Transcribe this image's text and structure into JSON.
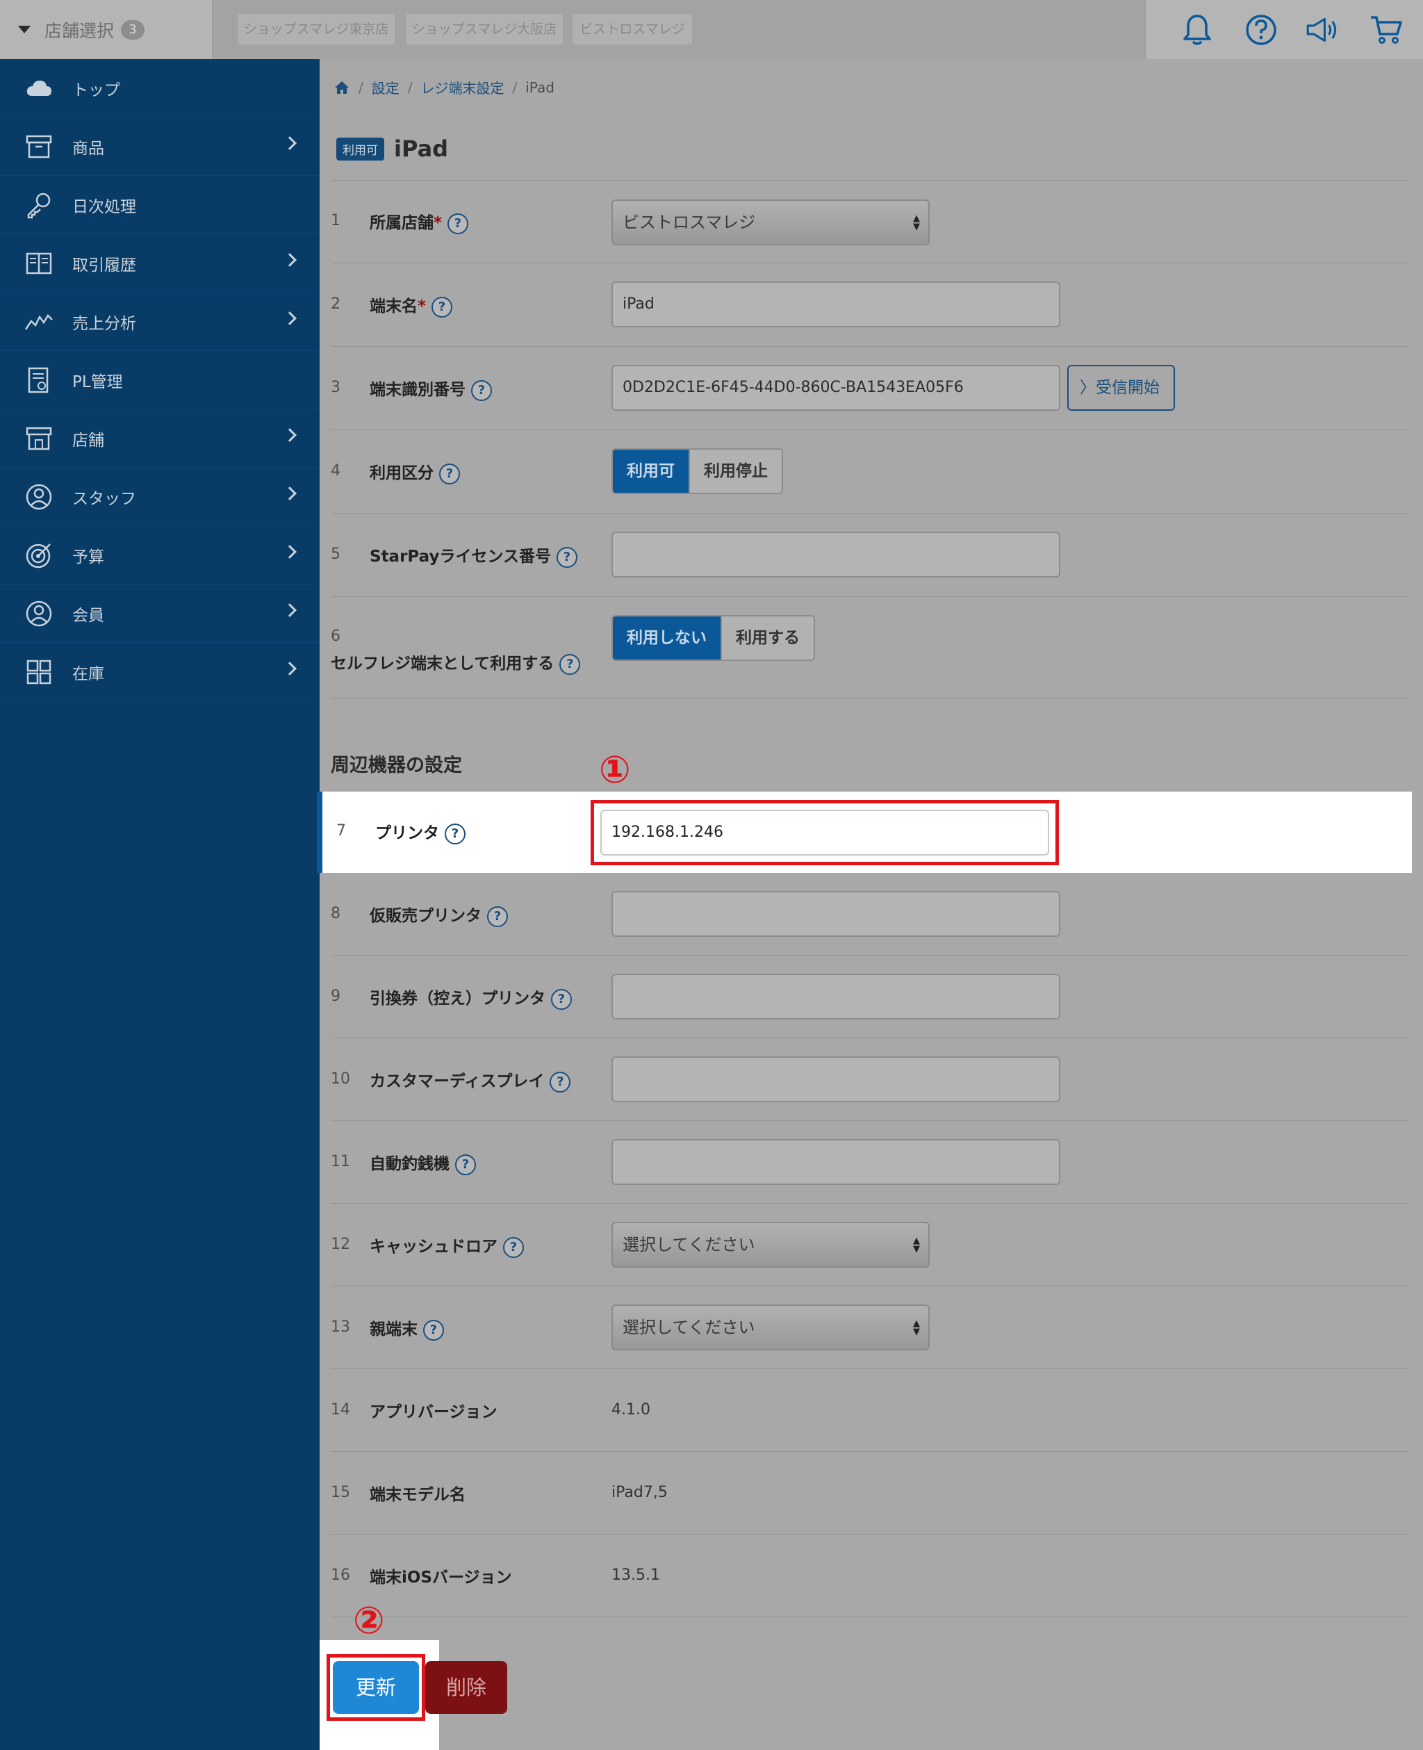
{
  "topbar": {
    "store_select_label": "店舗選択",
    "store_count": "3",
    "shops": [
      "ショップスマレジ東京店",
      "ショップスマレジ大阪店",
      "ビストロスマレジ"
    ]
  },
  "sidebar": {
    "items": [
      {
        "label": "トップ",
        "icon": "cloud-icon"
      },
      {
        "label": "商品",
        "icon": "box-icon"
      },
      {
        "label": "日次処理",
        "icon": "key-icon"
      },
      {
        "label": "取引履歴",
        "icon": "book-icon"
      },
      {
        "label": "売上分析",
        "icon": "chart-line-icon"
      },
      {
        "label": "PL管理",
        "icon": "report-icon"
      },
      {
        "label": "店舗",
        "icon": "store-icon"
      },
      {
        "label": "スタッフ",
        "icon": "person-icon"
      },
      {
        "label": "予算",
        "icon": "target-icon"
      },
      {
        "label": "会員",
        "icon": "member-icon"
      },
      {
        "label": "在庫",
        "icon": "grid-icon"
      }
    ]
  },
  "breadcrumb": {
    "items": [
      "設定",
      "レジ端末設定"
    ],
    "current": "iPad"
  },
  "page": {
    "badge": "利用可",
    "title": "iPad"
  },
  "form": {
    "rows": [
      {
        "num": "1",
        "label": "所属店舗",
        "value": "ビストロスマレジ"
      },
      {
        "num": "2",
        "label": "端末名",
        "value": "iPad"
      },
      {
        "num": "3",
        "label": "端末識別番号",
        "value": "0D2D2C1E-6F45-44D0-860C-BA1543EA05F6",
        "button": "受信開始"
      },
      {
        "num": "4",
        "label": "利用区分",
        "options": [
          "利用可",
          "利用停止"
        ]
      },
      {
        "num": "5",
        "label": "StarPayライセンス番号",
        "value": ""
      },
      {
        "num": "6",
        "label": "セルフレジ端末として利用する",
        "options": [
          "利用しない",
          "利用する"
        ]
      }
    ],
    "section_title": "周辺機器の設定",
    "peripheral_rows": [
      {
        "num": "7",
        "label": "プリンタ",
        "value": "192.168.1.246"
      },
      {
        "num": "8",
        "label": "仮販売プリンタ",
        "value": ""
      },
      {
        "num": "9",
        "label": "引換券（控え）プリンタ",
        "value": ""
      },
      {
        "num": "10",
        "label": "カスタマーディスプレイ",
        "value": ""
      },
      {
        "num": "11",
        "label": "自動釣銭機",
        "value": ""
      },
      {
        "num": "12",
        "label": "キャッシュドロア",
        "value": "選択してください"
      },
      {
        "num": "13",
        "label": "親端末",
        "value": "選択してください"
      },
      {
        "num": "14",
        "label": "アプリバージョン",
        "value": "4.1.0"
      },
      {
        "num": "15",
        "label": "端末モデル名",
        "value": "iPad7,5"
      },
      {
        "num": "16",
        "label": "端末iOSバージョン",
        "value": "13.5.1"
      }
    ]
  },
  "annotations": {
    "mark1": "①",
    "mark2": "②"
  },
  "buttons": {
    "update": "更新",
    "delete": "削除"
  },
  "colors": {
    "sidebar": "#083b65",
    "accent": "#0b5899",
    "highlight_border": "#e2141b",
    "update_button": "#1e88d6",
    "delete_button": "#7d1013"
  }
}
